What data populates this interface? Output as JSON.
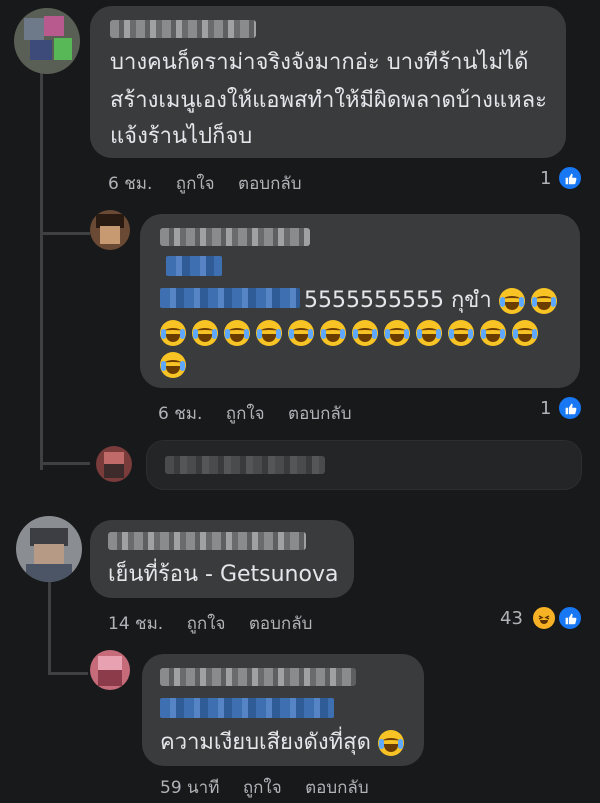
{
  "comments": [
    {
      "text_lines": [
        "บางคนก็ดราม่าจริงจังมากอ่ะ บางทีร้านไม่ได้",
        "สร้างเมนูเองให้แอพสทำให้มีผิดพลาดบ้างแหละ",
        "แจ้งร้านไปก็จบ"
      ],
      "time": "6 ชม.",
      "like_label": "ถูกใจ",
      "reply_label": "ตอบกลับ",
      "reaction_count": "1"
    },
    {
      "text_main": "5555555555 กุขำ",
      "time": "6 ชม.",
      "like_label": "ถูกใจ",
      "reply_label": "ตอบกลับ",
      "reaction_count": "1"
    },
    {
      "text": "เย็นที่ร้อน - Getsunova",
      "time": "14 ชม.",
      "like_label": "ถูกใจ",
      "reply_label": "ตอบกลับ",
      "reaction_count": "43"
    },
    {
      "text": "ความเงียบเสียงดังที่สุด",
      "time": "59 นาที",
      "like_label": "ถูกใจ",
      "reply_label": "ตอบกลับ"
    }
  ],
  "colors": {
    "background": "#18191a",
    "bubble": "#3a3b3c",
    "like": "#1877f2",
    "haha": "#f7b125"
  },
  "icons": {
    "like": "thumbs-up-icon",
    "haha": "laughing-face-icon",
    "tears_of_joy": "face-with-tears-of-joy-icon"
  }
}
